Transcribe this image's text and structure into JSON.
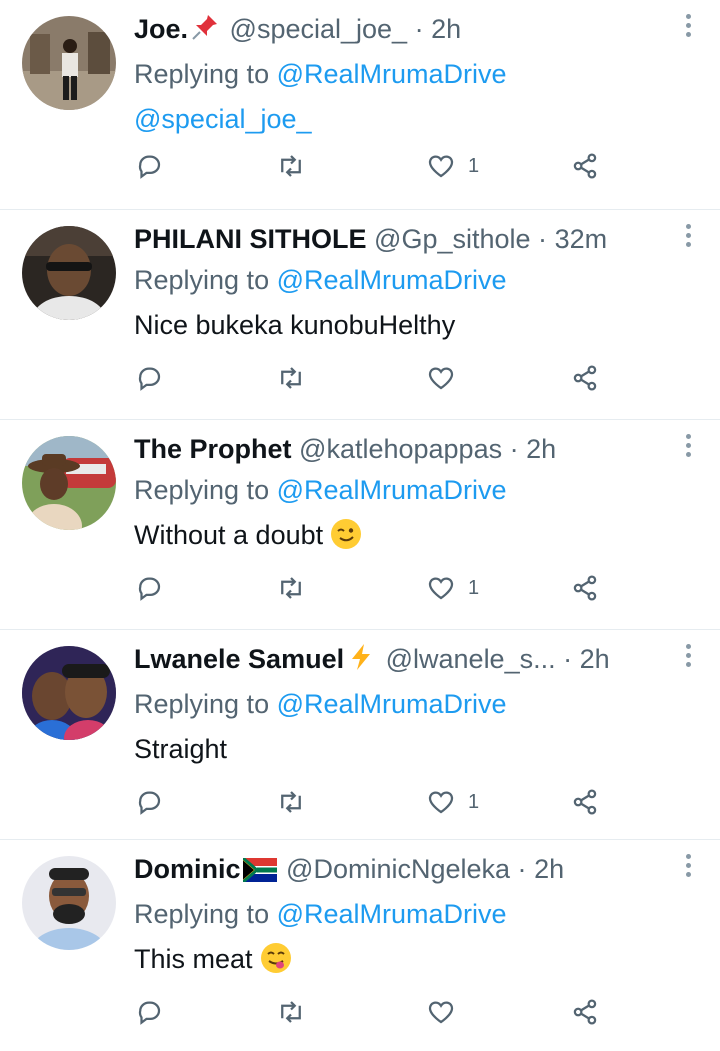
{
  "reply_prefix": "Replying to",
  "tweets": [
    {
      "name": "Joe.",
      "badge": "pin-emoji",
      "handle": "@special_joe_",
      "sep": "·",
      "time": "2h",
      "reply_to": "@RealMrumaDrive",
      "text": "@special_joe_",
      "likes": "1"
    },
    {
      "name": "PHILANI SITHOLE",
      "handle": "@Gp_sithole",
      "sep": "·",
      "time": "32m",
      "reply_to": "@RealMrumaDrive",
      "text": "Nice bukeka kunobuHelthy",
      "likes": ""
    },
    {
      "name": "The Prophet",
      "handle": "@katlehopappas",
      "sep": "·",
      "time": "2h",
      "reply_to": "@RealMrumaDrive",
      "text": "Without a doubt",
      "emoji": "winking-face",
      "likes": "1"
    },
    {
      "name": "Lwanele Samuel",
      "badge": "lightning-emoji",
      "handle": "@lwanele_s...",
      "sep": "·",
      "time": "2h",
      "reply_to": "@RealMrumaDrive",
      "text": "Straight",
      "likes": "1"
    },
    {
      "name": "Dominic",
      "badge": "south-africa-flag",
      "handle": "@DominicNgeleka",
      "sep": "·",
      "time": "2h",
      "reply_to": "@RealMrumaDrive",
      "text": "This meat",
      "emoji": "yum-face",
      "likes": ""
    }
  ],
  "colors": {
    "accent": "#1d9bf0",
    "muted": "#536471",
    "divider": "#e6ecf0"
  }
}
